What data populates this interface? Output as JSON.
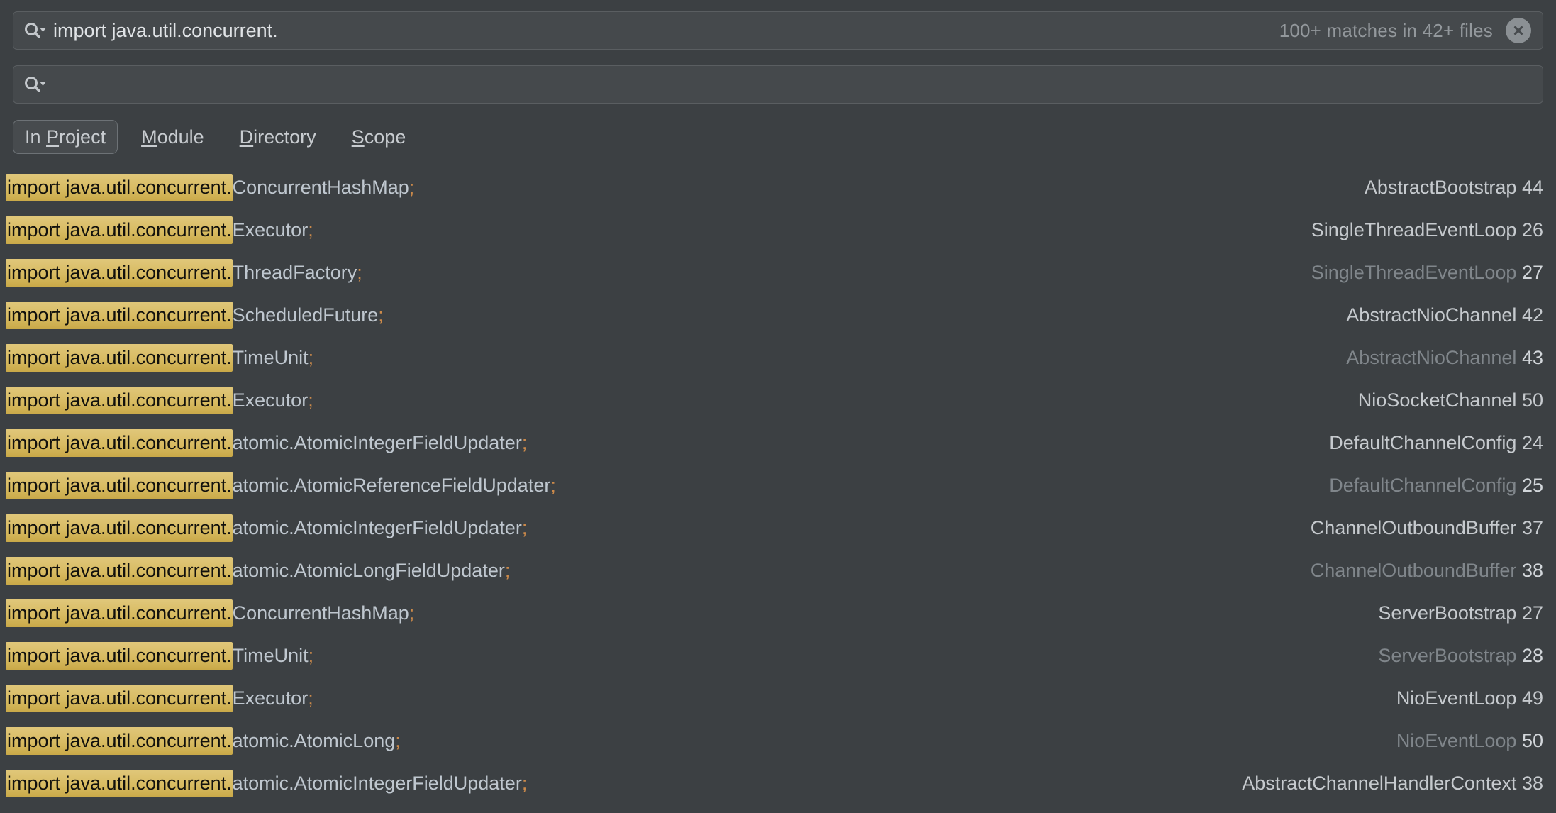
{
  "search": {
    "query": "import java.util.concurrent.",
    "placeholder": "",
    "match_count": "100+ matches in 42+ files",
    "search_icon": "search-icon",
    "dropdown_icon": "chevron-down-icon",
    "clear_icon": "close-icon"
  },
  "filter": {
    "value": "",
    "placeholder": "",
    "search_icon": "search-icon",
    "dropdown_icon": "chevron-down-icon"
  },
  "scope_tabs": [
    {
      "id": "in-project",
      "pre": "In ",
      "mnemonic": "P",
      "post": "roject",
      "selected": true
    },
    {
      "id": "module",
      "pre": "",
      "mnemonic": "M",
      "post": "odule",
      "selected": false
    },
    {
      "id": "directory",
      "pre": "",
      "mnemonic": "D",
      "post": "irectory",
      "selected": false
    },
    {
      "id": "scope",
      "pre": "",
      "mnemonic": "S",
      "post": "cope",
      "selected": false
    }
  ],
  "results": [
    {
      "match": "import java.util.concurrent.",
      "rest": "ConcurrentHashMap",
      "semi": ";",
      "file": "AbstractBootstrap",
      "line": "44",
      "dim": false
    },
    {
      "match": "import java.util.concurrent.",
      "rest": "Executor",
      "semi": ";",
      "file": "SingleThreadEventLoop",
      "line": "26",
      "dim": false
    },
    {
      "match": "import java.util.concurrent.",
      "rest": "ThreadFactory",
      "semi": ";",
      "file": "SingleThreadEventLoop",
      "line": "27",
      "dim": true
    },
    {
      "match": "import java.util.concurrent.",
      "rest": "ScheduledFuture",
      "semi": ";",
      "file": "AbstractNioChannel",
      "line": "42",
      "dim": false
    },
    {
      "match": "import java.util.concurrent.",
      "rest": "TimeUnit",
      "semi": ";",
      "file": "AbstractNioChannel",
      "line": "43",
      "dim": true
    },
    {
      "match": "import java.util.concurrent.",
      "rest": "Executor",
      "semi": ";",
      "file": "NioSocketChannel",
      "line": "50",
      "dim": false
    },
    {
      "match": "import java.util.concurrent.",
      "rest": "atomic.AtomicIntegerFieldUpdater",
      "semi": ";",
      "file": "DefaultChannelConfig",
      "line": "24",
      "dim": false
    },
    {
      "match": "import java.util.concurrent.",
      "rest": "atomic.AtomicReferenceFieldUpdater",
      "semi": ";",
      "file": "DefaultChannelConfig",
      "line": "25",
      "dim": true
    },
    {
      "match": "import java.util.concurrent.",
      "rest": "atomic.AtomicIntegerFieldUpdater",
      "semi": ";",
      "file": "ChannelOutboundBuffer",
      "line": "37",
      "dim": false
    },
    {
      "match": "import java.util.concurrent.",
      "rest": "atomic.AtomicLongFieldUpdater",
      "semi": ";",
      "file": "ChannelOutboundBuffer",
      "line": "38",
      "dim": true
    },
    {
      "match": "import java.util.concurrent.",
      "rest": "ConcurrentHashMap",
      "semi": ";",
      "file": "ServerBootstrap",
      "line": "27",
      "dim": false
    },
    {
      "match": "import java.util.concurrent.",
      "rest": "TimeUnit",
      "semi": ";",
      "file": "ServerBootstrap",
      "line": "28",
      "dim": true
    },
    {
      "match": "import java.util.concurrent.",
      "rest": "Executor",
      "semi": ";",
      "file": "NioEventLoop",
      "line": "49",
      "dim": false
    },
    {
      "match": "import java.util.concurrent.",
      "rest": "atomic.AtomicLong",
      "semi": ";",
      "file": "NioEventLoop",
      "line": "50",
      "dim": true
    },
    {
      "match": "import java.util.concurrent.",
      "rest": "atomic.AtomicIntegerFieldUpdater",
      "semi": ";",
      "file": "AbstractChannelHandlerContext",
      "line": "38",
      "dim": false
    }
  ]
}
